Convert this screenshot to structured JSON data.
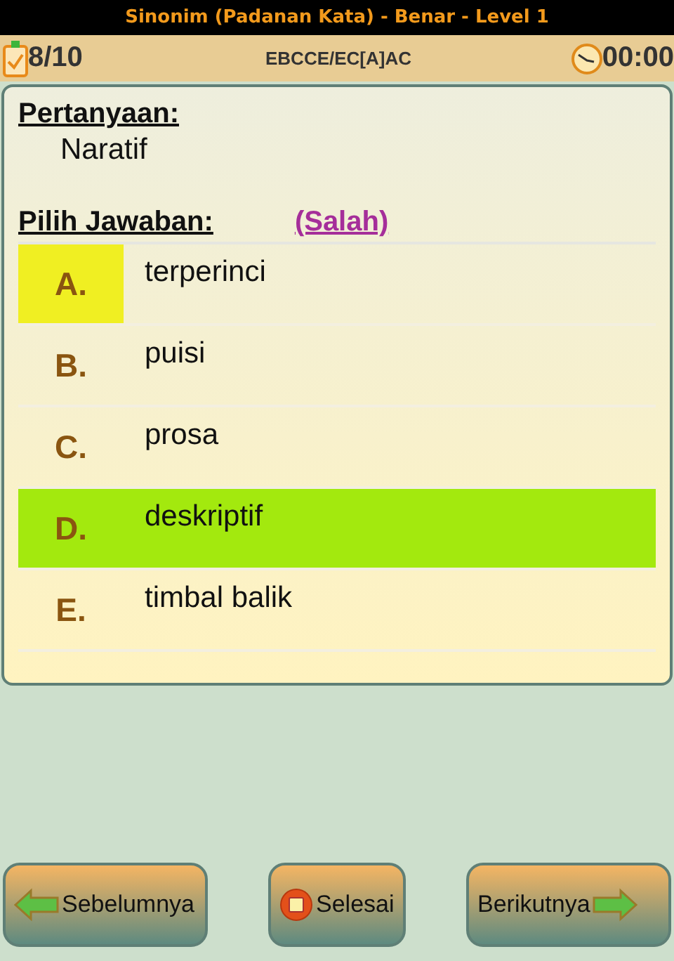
{
  "title": "Sinonim (Padanan Kata) - Benar - Level 1",
  "status": {
    "progress": "8/10",
    "answers": "EBCCE/EC[A]AC",
    "timer": "00:00"
  },
  "question": {
    "heading": "Pertanyaan:",
    "text": "Naratif"
  },
  "answer_heading": "Pilih Jawaban:",
  "verdict": "(Salah)",
  "options": [
    {
      "letter": "A.",
      "text": "terperinci",
      "selected": true,
      "correct": false
    },
    {
      "letter": "B.",
      "text": "puisi",
      "selected": false,
      "correct": false
    },
    {
      "letter": "C.",
      "text": "prosa",
      "selected": false,
      "correct": false
    },
    {
      "letter": "D.",
      "text": "deskriptif",
      "selected": false,
      "correct": true
    },
    {
      "letter": "E.",
      "text": "timbal balik",
      "selected": false,
      "correct": false
    }
  ],
  "buttons": [
    {
      "kind": "prev",
      "label": "Sebelumnya"
    },
    {
      "kind": "finish",
      "label": "Selesai"
    },
    {
      "kind": "next",
      "label": "Berikutnya"
    }
  ]
}
